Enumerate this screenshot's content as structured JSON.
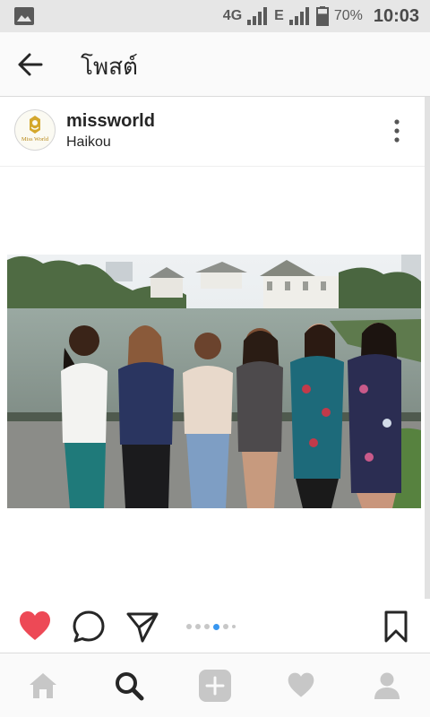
{
  "status_bar": {
    "network_type": "4G",
    "data_indicator": "E",
    "battery_percent": "70%",
    "battery_level": 0.7,
    "time": "10:03",
    "icons": [
      "gallery-icon",
      "signal-icon",
      "signal-icon",
      "battery-icon"
    ]
  },
  "header": {
    "title": "โพสต์",
    "back_icon": "arrow-left-icon"
  },
  "post": {
    "username": "missworld",
    "location": "Haikou",
    "avatar_text": "Miss World",
    "more_icon": "more-vertical-icon",
    "liked": true,
    "carousel": {
      "total": 6,
      "active_index": 3
    }
  },
  "actions": {
    "icons": [
      "heart-filled-icon",
      "comment-icon",
      "share-icon",
      "bookmark-icon"
    ]
  },
  "bottom_nav": {
    "items": [
      "home-icon",
      "search-icon",
      "add-icon",
      "heart-icon",
      "profile-icon"
    ],
    "active": "search-icon"
  },
  "colors": {
    "like_red": "#ed4956",
    "active_dot": "#3897f0",
    "status_bar_bg": "#e6e6e6",
    "header_bg": "#fafafa"
  }
}
